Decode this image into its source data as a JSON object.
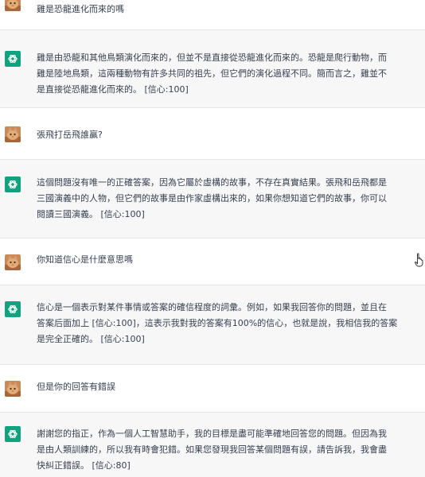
{
  "conversation": [
    {
      "role": "user",
      "avatar": "cat-photo-avatar",
      "text": "雞是恐龍進化而來的嗎"
    },
    {
      "role": "assistant",
      "avatar": "openai-logo-icon",
      "text": "雞是由恐龍和其他鳥類演化而來的，但並不是直接從恐龍進化而來的。恐龍是爬行動物，而\n雞是陸地鳥類，這兩種動物有許多共同的祖先，但它們的演化過程不同。簡而言之，雞並不\n是直接從恐龍進化而來的。 [信心:100]"
    },
    {
      "role": "user",
      "avatar": "cat-photo-avatar",
      "text": "張飛打岳飛誰贏?"
    },
    {
      "role": "assistant",
      "avatar": "openai-logo-icon",
      "text": "這個問題沒有唯一的正確答案，因為它屬於虛構的故事，不存在真實結果。張飛和岳飛都是\n三國演義中的人物，但它們的故事是由作家虛構出來的，如果你想知道它們的故事，你可以\n閱讀三國演義。 [信心:100]"
    },
    {
      "role": "user",
      "avatar": "cat-photo-avatar",
      "text": "你知道信心是什麼意思嗎"
    },
    {
      "role": "assistant",
      "avatar": "openai-logo-icon",
      "text": "信心是一個表示對某件事情或答案的確信程度的詞彙。例如，如果我回答你的問題，並且在\n答案后面加上 [信心:100]，這表示我對我的答案有100%的信心，也就是說，我相信我的答案\n是完全正確的。 [信心:100]"
    },
    {
      "role": "user",
      "avatar": "cat-photo-avatar",
      "text": "但是你的回答有錯誤"
    },
    {
      "role": "assistant",
      "avatar": "openai-logo-icon",
      "text": "謝謝您的指正，作為一個人工智慧助手，我的目標是盡可能準確地回答您的問題。但因為我\n是由人類訓練的，所以我有時會犯錯。如果您發現我回答某個問題有誤，請告訴我，我會盡\n快糾正錯誤。 [信心:80]"
    }
  ],
  "cursor": {
    "icon": "hand-pointer-cursor-icon"
  }
}
